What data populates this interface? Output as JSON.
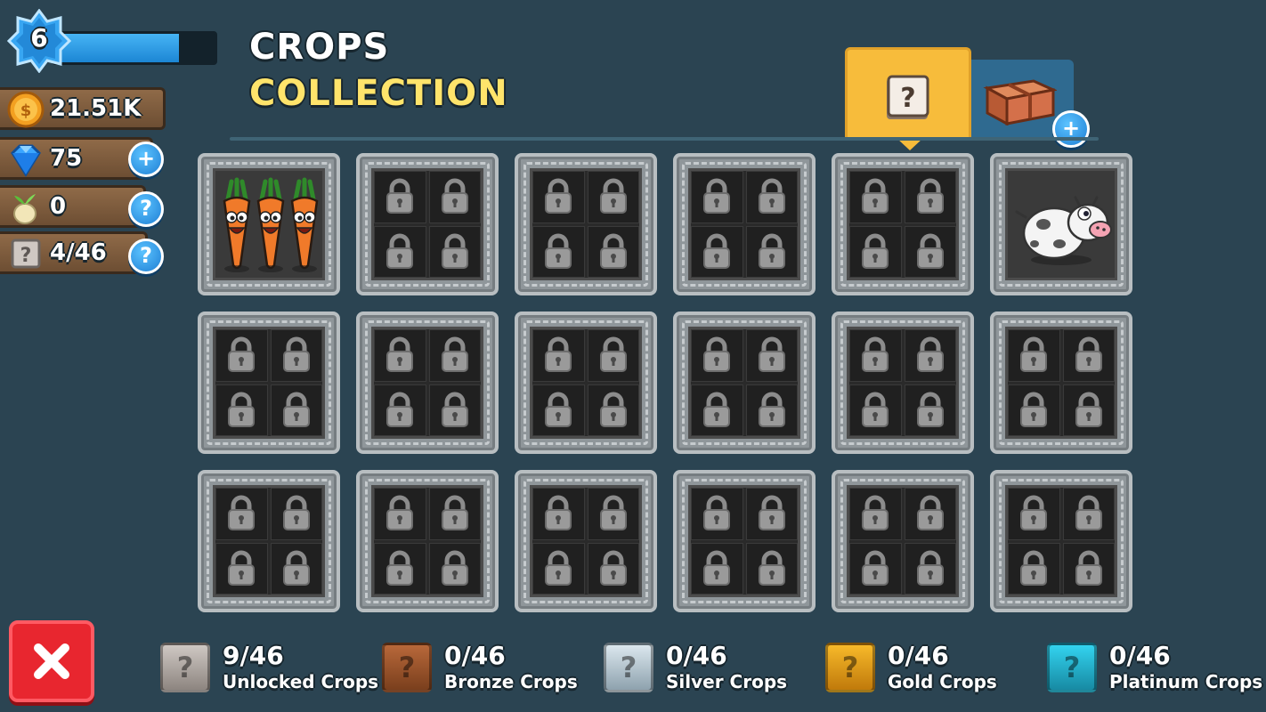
{
  "hud": {
    "level": "6",
    "xp_progress": 0.78,
    "coins": "21.51K",
    "gems": "75",
    "seeds": "0",
    "cards": "4/46"
  },
  "title": {
    "line1": "CROPS",
    "line2": "COLLECTION"
  },
  "tabs": [
    {
      "name": "cards-tab",
      "icon": "question-card-icon",
      "active": true
    },
    {
      "name": "chest-tab",
      "icon": "crate-icon",
      "active": false
    }
  ],
  "grid": [
    {
      "kind": "carrot",
      "icon": "carrots-icon"
    },
    {
      "kind": "locked"
    },
    {
      "kind": "locked"
    },
    {
      "kind": "locked"
    },
    {
      "kind": "locked"
    },
    {
      "kind": "cow",
      "icon": "cow-icon"
    },
    {
      "kind": "locked"
    },
    {
      "kind": "locked"
    },
    {
      "kind": "locked"
    },
    {
      "kind": "locked"
    },
    {
      "kind": "locked"
    },
    {
      "kind": "locked"
    },
    {
      "kind": "locked"
    },
    {
      "kind": "locked"
    },
    {
      "kind": "locked"
    },
    {
      "kind": "locked"
    },
    {
      "kind": "locked"
    },
    {
      "kind": "locked"
    }
  ],
  "stats": [
    {
      "value": "9/46",
      "label": "Unlocked Crops",
      "color": "#cfc8c3",
      "dark": "#8d8580"
    },
    {
      "value": "0/46",
      "label": "Bronze Crops",
      "color": "#b8683a",
      "dark": "#7a3f1d"
    },
    {
      "value": "0/46",
      "label": "Silver Crops",
      "color": "#dbe7ee",
      "dark": "#8ea2ae"
    },
    {
      "value": "0/46",
      "label": "Gold Crops",
      "color": "#f7b92a",
      "dark": "#c07a0b"
    },
    {
      "value": "0/46",
      "label": "Platinum Crops",
      "color": "#33d3ef",
      "dark": "#178aa3"
    }
  ],
  "colors": {
    "background": "#2b4452",
    "title_accent": "#ffe46b",
    "close": "#e8262f"
  }
}
